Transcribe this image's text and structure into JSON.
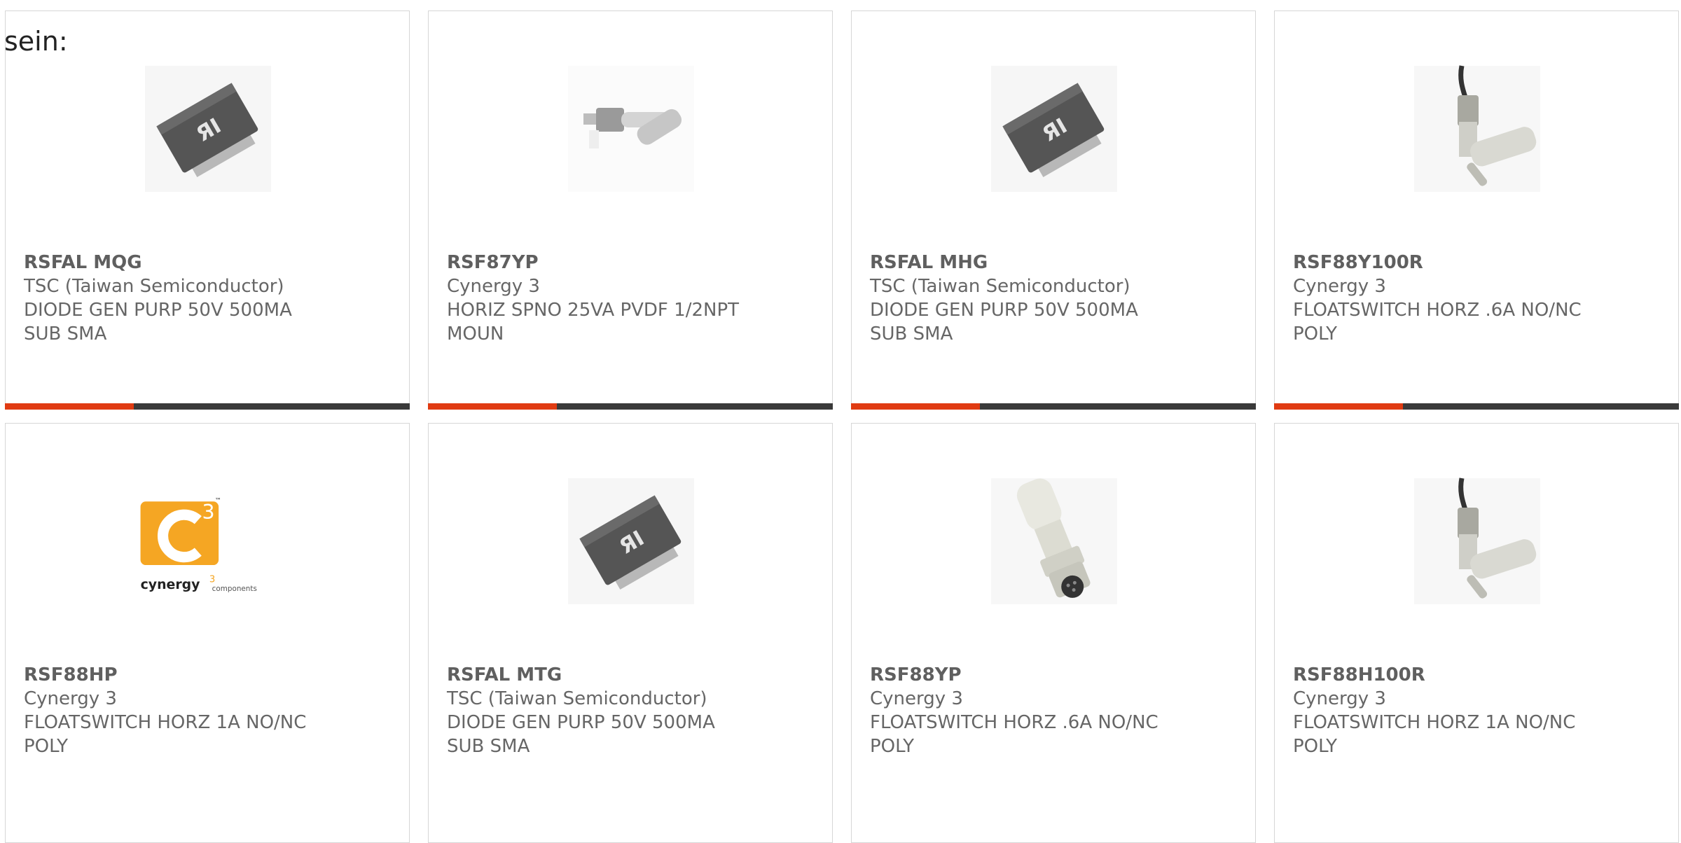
{
  "intro_text": "sein:",
  "colors": {
    "accent": "#e03b12",
    "bar": "#3a3a3a",
    "text": "#666666",
    "border": "#d6d6d6"
  },
  "products": [
    {
      "part": "RSFAL MQG",
      "manufacturer": "TSC (Taiwan Semiconductor)",
      "desc1": "DIODE GEN PURP 50V 500MA",
      "desc2": "SUB SMA",
      "image": "smd-diode-icon"
    },
    {
      "part": "RSF87YP",
      "manufacturer": "Cynergy 3",
      "desc1": "HORIZ SPNO 25VA PVDF 1/2NPT",
      "desc2": "MOUN",
      "image": "horizontal-float-switch-icon"
    },
    {
      "part": "RSFAL MHG",
      "manufacturer": "TSC (Taiwan Semiconductor)",
      "desc1": "DIODE GEN PURP 50V 500MA",
      "desc2": "SUB SMA",
      "image": "smd-diode-icon"
    },
    {
      "part": "RSF88Y100R",
      "manufacturer": "Cynergy 3",
      "desc1": "FLOATSWITCH HORZ .6A NO/NC",
      "desc2": "POLY",
      "image": "float-switch-cable-icon"
    },
    {
      "part": "RSF88HP",
      "manufacturer": "Cynergy 3",
      "desc1": "FLOATSWITCH HORZ 1A NO/NC",
      "desc2": "POLY",
      "image": "cynergy3-logo",
      "logo_main": "cynergy",
      "logo_sup": "3",
      "logo_sub": "components",
      "logo_tm": "™"
    },
    {
      "part": "RSFAL MTG",
      "manufacturer": "TSC (Taiwan Semiconductor)",
      "desc1": "DIODE GEN PURP 50V 500MA",
      "desc2": "SUB SMA",
      "image": "smd-diode-icon"
    },
    {
      "part": "RSF88YP",
      "manufacturer": "Cynergy 3",
      "desc1": "FLOATSWITCH HORZ .6A NO/NC",
      "desc2": "POLY",
      "image": "float-switch-connector-icon"
    },
    {
      "part": "RSF88H100R",
      "manufacturer": "Cynergy 3",
      "desc1": "FLOATSWITCH HORZ 1A NO/NC",
      "desc2": "POLY",
      "image": "float-switch-cable-icon"
    }
  ]
}
